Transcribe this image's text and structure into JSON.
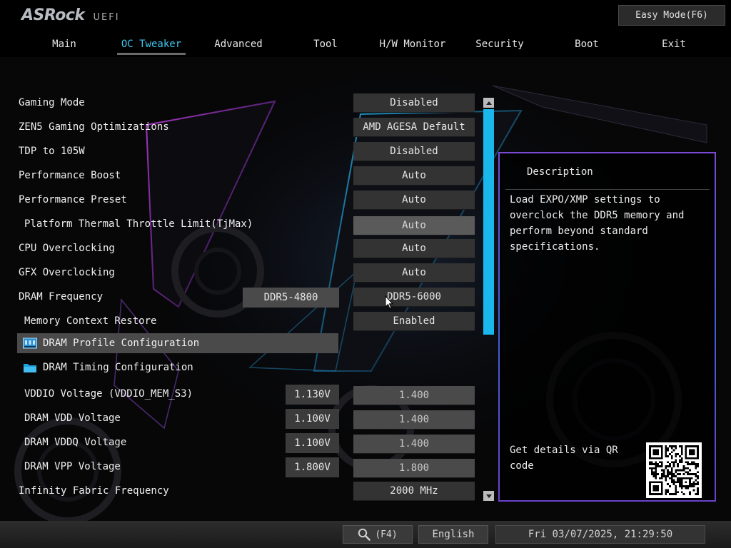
{
  "header": {
    "brand": "ASRock",
    "product": "UEFI",
    "easy_mode_button": "Easy Mode(F6)"
  },
  "nav": {
    "tabs": [
      {
        "label": "Main",
        "active": false
      },
      {
        "label": "OC Tweaker",
        "active": true
      },
      {
        "label": "Advanced",
        "active": false
      },
      {
        "label": "Tool",
        "active": false
      },
      {
        "label": "H/W Monitor",
        "active": false
      },
      {
        "label": "Security",
        "active": false
      },
      {
        "label": "Boot",
        "active": false
      },
      {
        "label": "Exit",
        "active": false
      }
    ]
  },
  "settings": {
    "gaming_mode": {
      "label": "Gaming Mode",
      "value": "Disabled"
    },
    "zen5_gaming": {
      "label": "ZEN5 Gaming Optimizations",
      "value": "AMD AGESA Default"
    },
    "tdp_105w": {
      "label": "TDP to 105W",
      "value": "Disabled"
    },
    "performance_boost": {
      "label": "Performance Boost",
      "value": "Auto"
    },
    "performance_preset": {
      "label": "Performance Preset",
      "value": "Auto"
    },
    "thermal_throttle": {
      "label": "Platform Thermal Throttle Limit(TjMax)",
      "value": "Auto"
    },
    "cpu_overclocking": {
      "label": "CPU Overclocking",
      "value": "Auto"
    },
    "gfx_overclocking": {
      "label": "GFX Overclocking",
      "value": "Auto"
    },
    "dram_frequency": {
      "label": "DRAM Frequency",
      "current": "DDR5-4800",
      "value": "DDR5-6000"
    },
    "memory_context_restore": {
      "label": "Memory Context Restore",
      "value": "Enabled"
    },
    "dram_profile_config": {
      "label": "DRAM Profile Configuration",
      "icon": "memory-module-icon"
    },
    "dram_timing_config": {
      "label": "DRAM Timing Configuration",
      "icon": "folder-icon"
    },
    "vddio_voltage": {
      "label": "VDDIO Voltage (VDDIO_MEM_S3)",
      "current": "1.130V",
      "value": "1.400"
    },
    "dram_vdd": {
      "label": "DRAM VDD Voltage",
      "current": "1.100V",
      "value": "1.400"
    },
    "dram_vddq": {
      "label": "DRAM VDDQ Voltage",
      "current": "1.100V",
      "value": "1.400"
    },
    "dram_vpp": {
      "label": "DRAM VPP Voltage",
      "current": "1.800V",
      "value": "1.800"
    },
    "infinity_fabric": {
      "label": "Infinity Fabric Frequency",
      "value": "2000 MHz"
    }
  },
  "description": {
    "title": "Description",
    "text": "Load EXPO/XMP settings to overclock the DDR5 memory and perform beyond standard specifications.",
    "qr_text": "Get details via QR code"
  },
  "footer": {
    "search_key": "(F4)",
    "language": "English",
    "datetime": "Fri 03/07/2025, 21:29:50"
  },
  "colors": {
    "accent": "#3fc6ef",
    "scrollbar": "#1ab7ec",
    "panel_border": "#6a4ad6"
  }
}
